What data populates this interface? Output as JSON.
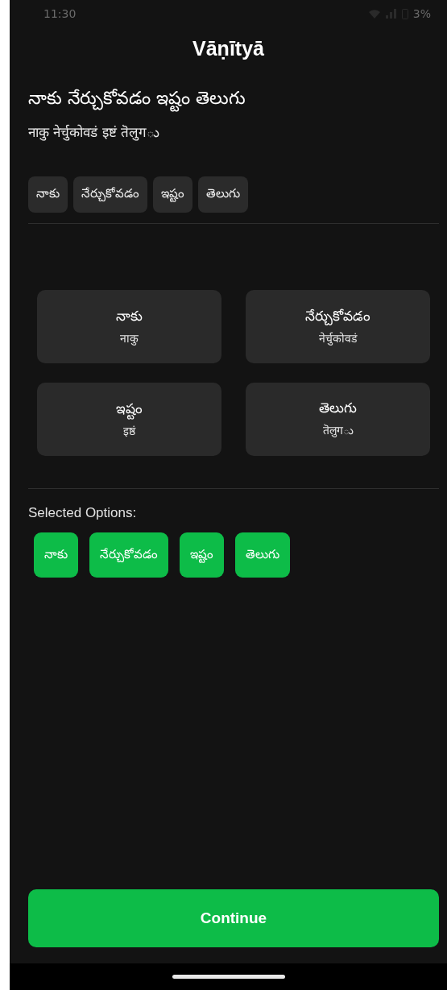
{
  "status_bar": {
    "time": "11:30",
    "battery": "3%"
  },
  "app_title": "Vāṇītyā",
  "sentence": {
    "text": "నాకు నేర్చుకోవడం ఇష్టం తెలుగు",
    "transliteration": "नाकु नेर्चुकोवडं इष्टं तॆलुगు"
  },
  "word_chips": [
    "నాకు",
    "నేర్చుకోవడం",
    "ఇష్టం",
    "తెలుగు"
  ],
  "options": [
    {
      "word": "నాకు",
      "transliteration": "नाकु"
    },
    {
      "word": "నేర్చుకోవడం",
      "transliteration": "नेर्चुकोवडं"
    },
    {
      "word": "ఇష్టం",
      "transliteration": "इष्ठं"
    },
    {
      "word": "తెలుగు",
      "transliteration": "तॆलुगు"
    }
  ],
  "selected_label": "Selected Options:",
  "selected_options": [
    "నాకు",
    "నేర్చుకోవడం",
    "ఇష్టం",
    "తెలుగు"
  ],
  "continue_button": "Continue"
}
